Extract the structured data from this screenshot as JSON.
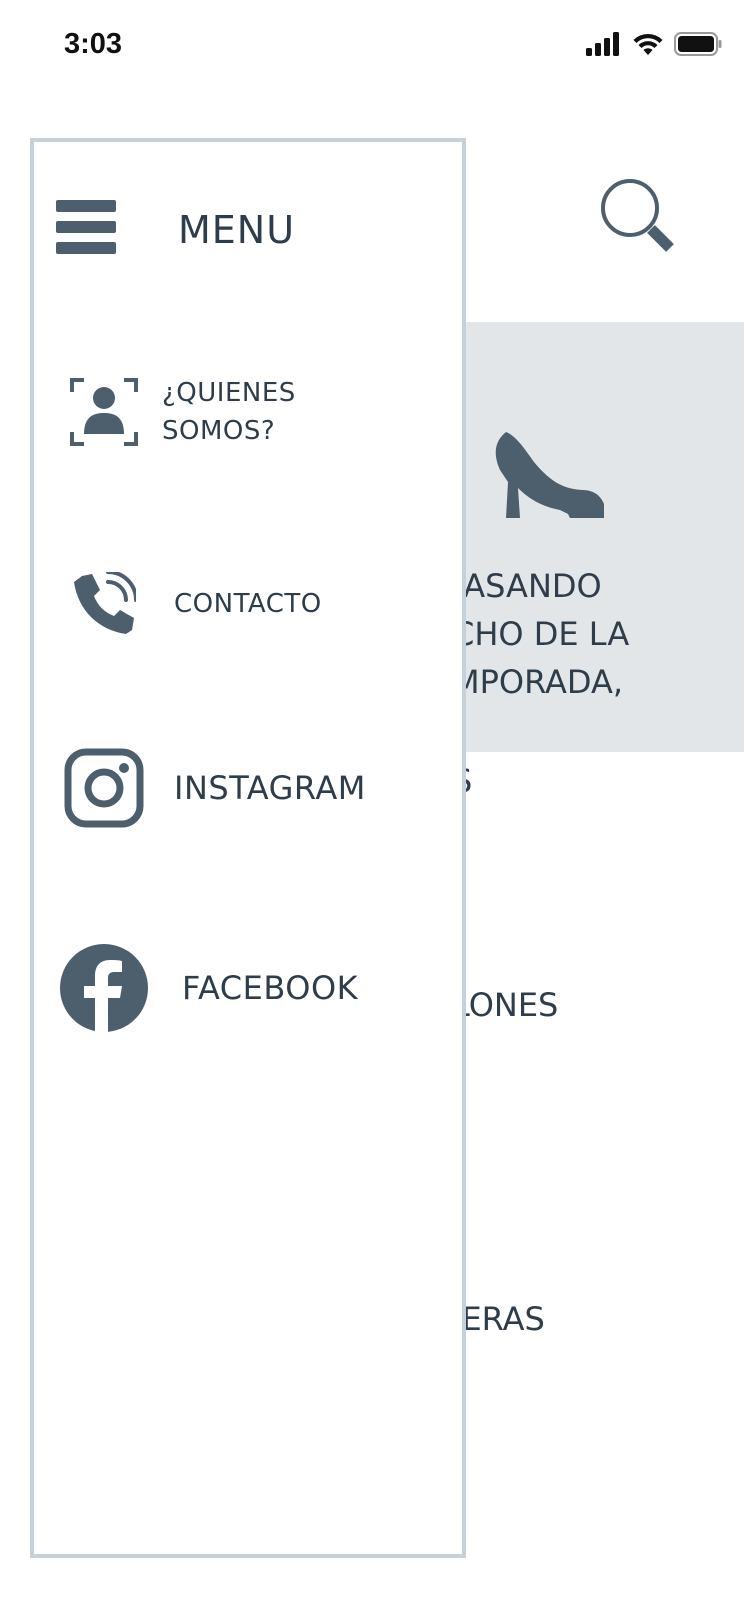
{
  "status_bar": {
    "time": "3:03",
    "icons": [
      "cellular-signal-icon",
      "wifi-icon",
      "battery-icon"
    ]
  },
  "background_page": {
    "banner": {
      "icon": "high-heel-shoe-icon",
      "text": "PASANDO\nCHO DE LA\nMPORADA,"
    },
    "partial_items": [
      "S",
      "LONES",
      "IERAS"
    ]
  },
  "drawer": {
    "title": "MENU",
    "items": [
      {
        "label": "¿QUIENES\nSOMOS?",
        "icon": "user-profile-icon"
      },
      {
        "label": "CONTACTO",
        "icon": "phone-call-icon"
      },
      {
        "label": "INSTAGRAM",
        "icon": "instagram-icon"
      },
      {
        "label": "FACEBOOK",
        "icon": "facebook-icon"
      }
    ]
  },
  "colors": {
    "icon": "#4d5e6d",
    "text": "#2f3d4a",
    "drawer_border": "#c5d0d9",
    "banner_bg": "#e3e6e9"
  }
}
